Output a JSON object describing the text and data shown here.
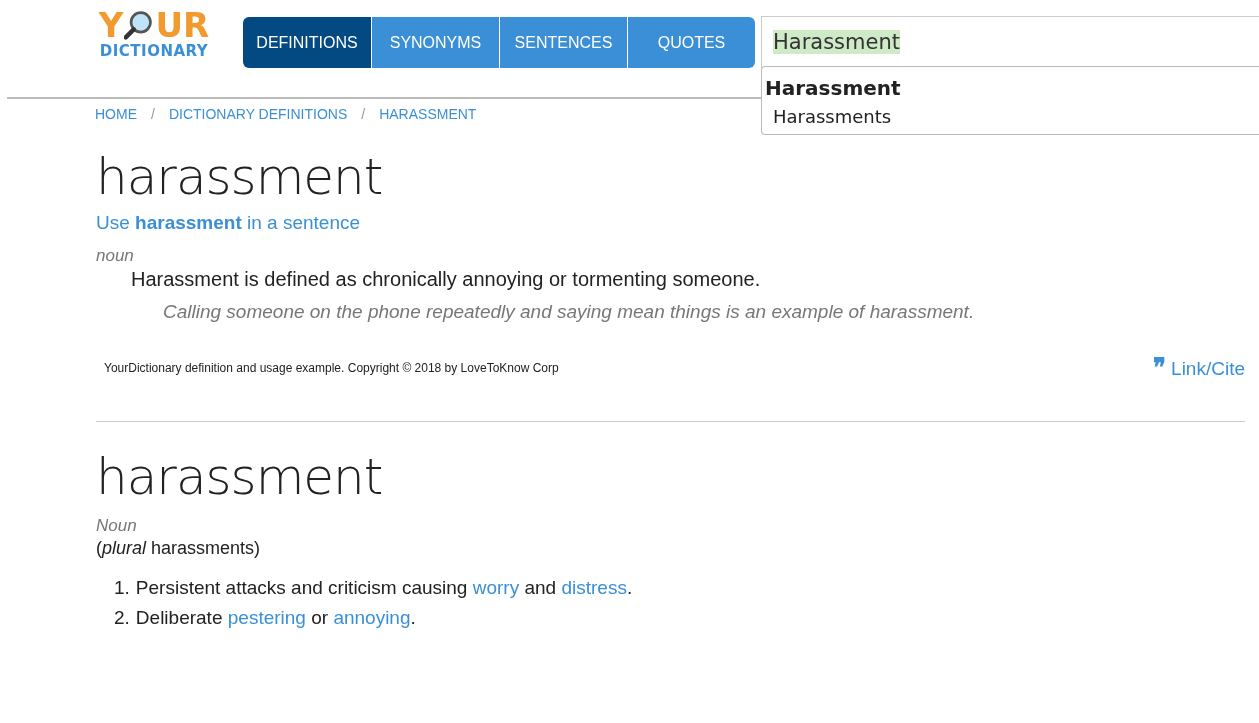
{
  "logo": {
    "top_left": "Y",
    "top_right": "UR",
    "bottom": "DICTIONARY"
  },
  "tabs": [
    {
      "label": "DEFINITIONS",
      "selected": true
    },
    {
      "label": "SYNONYMS",
      "selected": false
    },
    {
      "label": "SENTENCES",
      "selected": false
    },
    {
      "label": "QUOTES",
      "selected": false
    }
  ],
  "search": {
    "value": "Harassment",
    "suggestions": [
      {
        "label": "Harassment",
        "selected": true
      },
      {
        "label": "Harassments",
        "selected": false
      }
    ]
  },
  "breadcrumb": {
    "separator": "/",
    "items": [
      "HOME",
      "DICTIONARY DEFINITIONS",
      "HARASSMENT"
    ]
  },
  "entries": [
    {
      "kind": "simple",
      "headword": "harassment",
      "sentence_link": "Use **harassment** in a sentence",
      "pos": "noun",
      "definition": "Harassment is defined as chronically annoying or tormenting someone.",
      "example": "Calling someone on the phone repeatedly and saying mean things is an example of harassment.",
      "copyright": "YourDictionary definition and usage example. Copyright © 2018 by LoveToKnow Corp",
      "cite_icon": "❞",
      "cite": "Link/Cite"
    },
    {
      "kind": "wiki",
      "headword": "harassment",
      "pos": "Noun",
      "plural": "(*plural* harassments)",
      "senses": [
        {
          "number": "1.",
          "parts": [
            {
              "text": "Persistent attacks and criticism causing ",
              "link": false
            },
            {
              "text": "worry",
              "link": true
            },
            {
              "text": " and ",
              "link": false
            },
            {
              "text": "distress",
              "link": true
            },
            {
              "text": ".",
              "link": false
            }
          ]
        },
        {
          "number": "2.",
          "parts": [
            {
              "text": "Deliberate ",
              "link": false
            },
            {
              "text": "pestering",
              "link": true
            },
            {
              "text": " or ",
              "link": false
            },
            {
              "text": "annoying",
              "link": true
            },
            {
              "text": ".",
              "link": false
            }
          ]
        }
      ]
    }
  ]
}
